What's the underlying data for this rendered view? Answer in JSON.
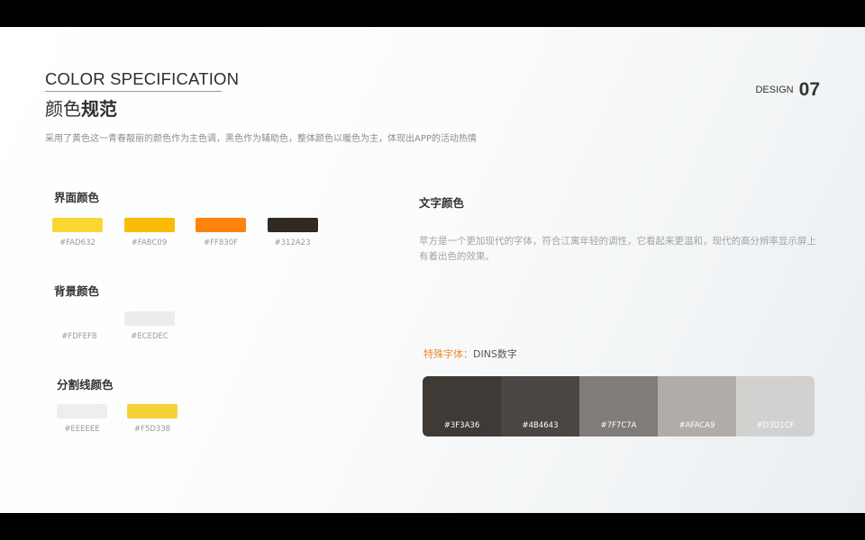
{
  "header": {
    "title_en": "COLOR SPECIFICATION",
    "title_cn_regular": "颜色",
    "title_cn_bold": "规范",
    "subtitle": "采用了黄色这一青春靓丽的颜色作为主色调，黑色作为辅助色，整体颜色以暖色为主，体现出APP的活动热情",
    "design_label": "DESIGN",
    "design_number": "07"
  },
  "colors": {
    "accent": "#F08A2E",
    "text_dark": "#333333",
    "text_muted": "#9A9A9A"
  },
  "interface_colors": {
    "title": "界面颜色",
    "swatches": [
      {
        "hex": "#FAD632",
        "label": "#FAD632"
      },
      {
        "hex": "#FABC09",
        "label": "#FABC09"
      },
      {
        "hex": "#FF830F",
        "label": "#FF830F"
      },
      {
        "hex": "#312A23",
        "label": "#312A23"
      }
    ]
  },
  "background_colors": {
    "title": "背景颜色",
    "swatches": [
      {
        "hex": "#FDFEFB",
        "label": "#FDFEFB"
      },
      {
        "hex": "#ECEDEC",
        "label": "#ECEDEC"
      }
    ]
  },
  "divider_colors": {
    "title": "分割线颜色",
    "swatches": [
      {
        "hex": "#EEEEEE",
        "label": "#EEEEEE"
      },
      {
        "hex": "#F5D338",
        "label": "#F5D338"
      }
    ]
  },
  "text_colors": {
    "title": "文字颜色",
    "description": "苹方是一个更加现代的字体，符合江寓年轻的调性，它看起来更温和，现代的高分辨率显示屏上有着出色的效果。",
    "special_label": "特殊字体：",
    "special_value": "DINS数字",
    "strip": [
      {
        "hex": "#3F3A36",
        "label": "#3F3A36"
      },
      {
        "hex": "#4B4643",
        "label": "#4B4643"
      },
      {
        "hex": "#7F7C7A",
        "label": "#7F7C7A"
      },
      {
        "hex": "#AFACA9",
        "label": "#AFACA9"
      },
      {
        "hex": "#D3D1CF",
        "label": "#D3D1CF"
      }
    ]
  }
}
